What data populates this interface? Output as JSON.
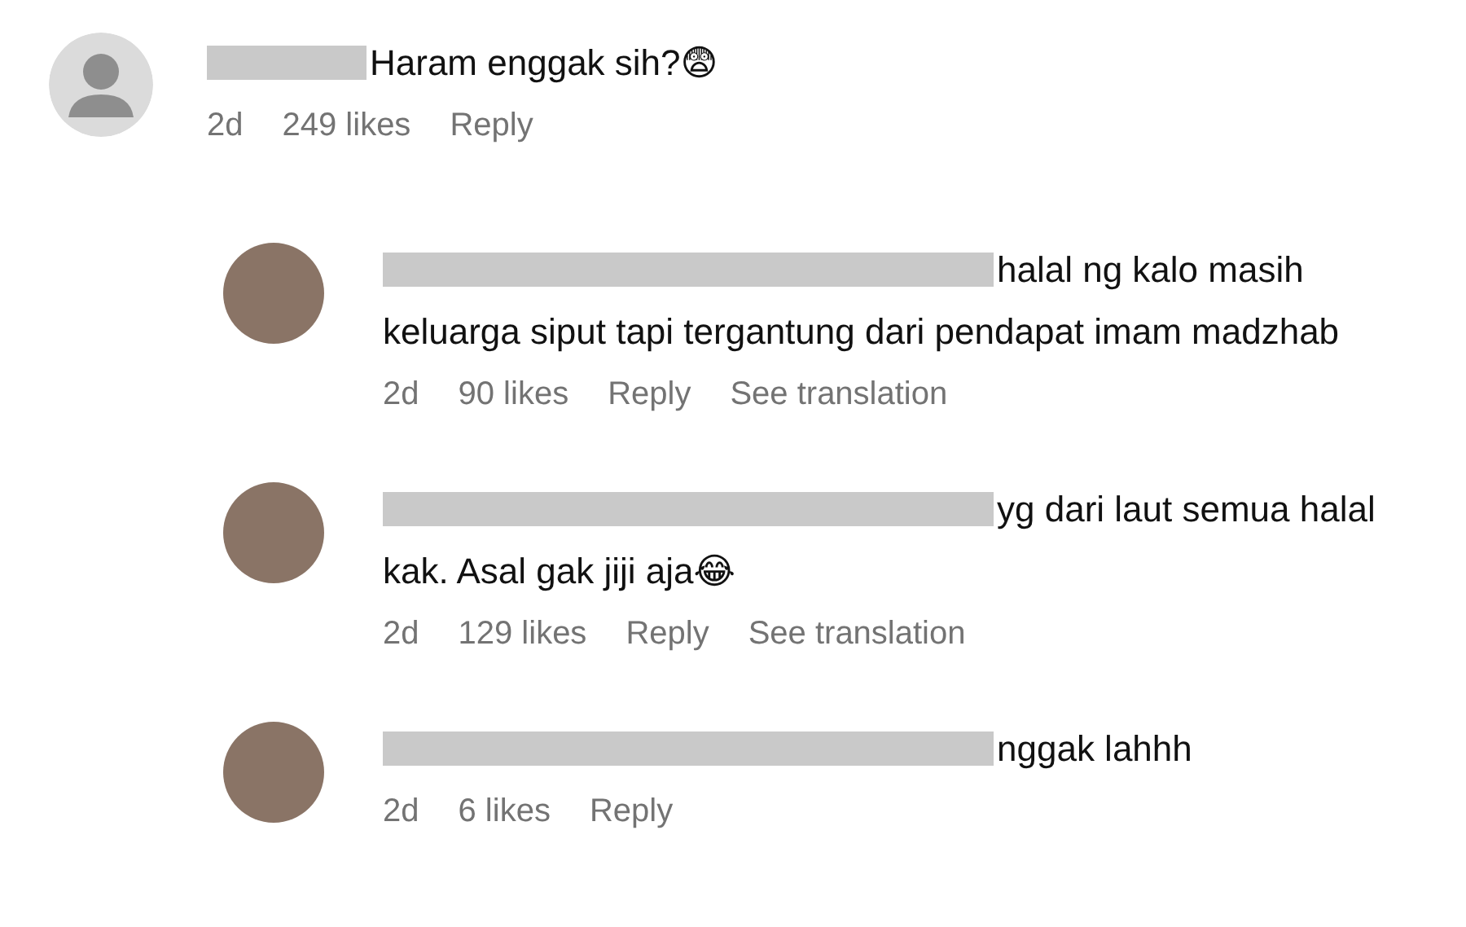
{
  "comment": {
    "text": "Haram enggak sih?😨",
    "time": "2d",
    "likes": "249 likes",
    "reply": "Reply",
    "replies": [
      {
        "text": "halal ng kalo masih keluarga siput tapi tergantung dari pendapat imam madzhab",
        "time": "2d",
        "likes": "90 likes",
        "reply": "Reply",
        "translation": "See translation"
      },
      {
        "text": "yg dari laut semua halal kak. Asal gak jiji aja😂",
        "time": "2d",
        "likes": "129 likes",
        "reply": "Reply",
        "translation": "See translation"
      },
      {
        "text": "nggak lahhh",
        "time": "2d",
        "likes": "6 likes",
        "reply": "Reply"
      }
    ]
  }
}
